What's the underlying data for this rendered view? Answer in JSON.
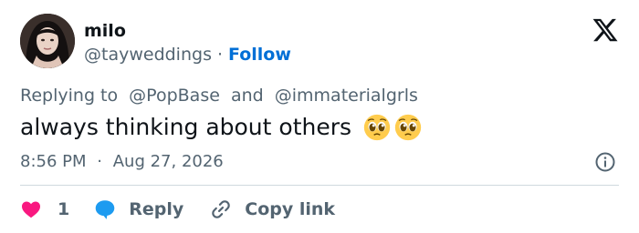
{
  "user": {
    "display_name": "milo",
    "handle": "@tayweddings",
    "separator": "·",
    "follow_label": "Follow",
    "avatar_icon": "profile-photo"
  },
  "brand": {
    "logo_icon": "x-logo"
  },
  "tweet": {
    "replying_prefix": "Replying to",
    "mentions": [
      "@PopBase",
      "@immaterialgrls"
    ],
    "mention_joiner": "and",
    "text": "always thinking about others",
    "emojis": [
      "pleading-face",
      "pleading-face"
    ],
    "time": "8:56 PM",
    "date": "Aug 27, 2026",
    "time_separator": "·",
    "info_icon": "info-icon"
  },
  "actions": {
    "like_count": "1",
    "reply_label": "Reply",
    "copy_label": "Copy link"
  },
  "colors": {
    "text_primary": "#0f1419",
    "text_secondary": "#536471",
    "follow_blue": "#006fd6",
    "like_pink": "#f91880",
    "reply_blue": "#1d9bf0",
    "divider": "#cfd9de"
  }
}
